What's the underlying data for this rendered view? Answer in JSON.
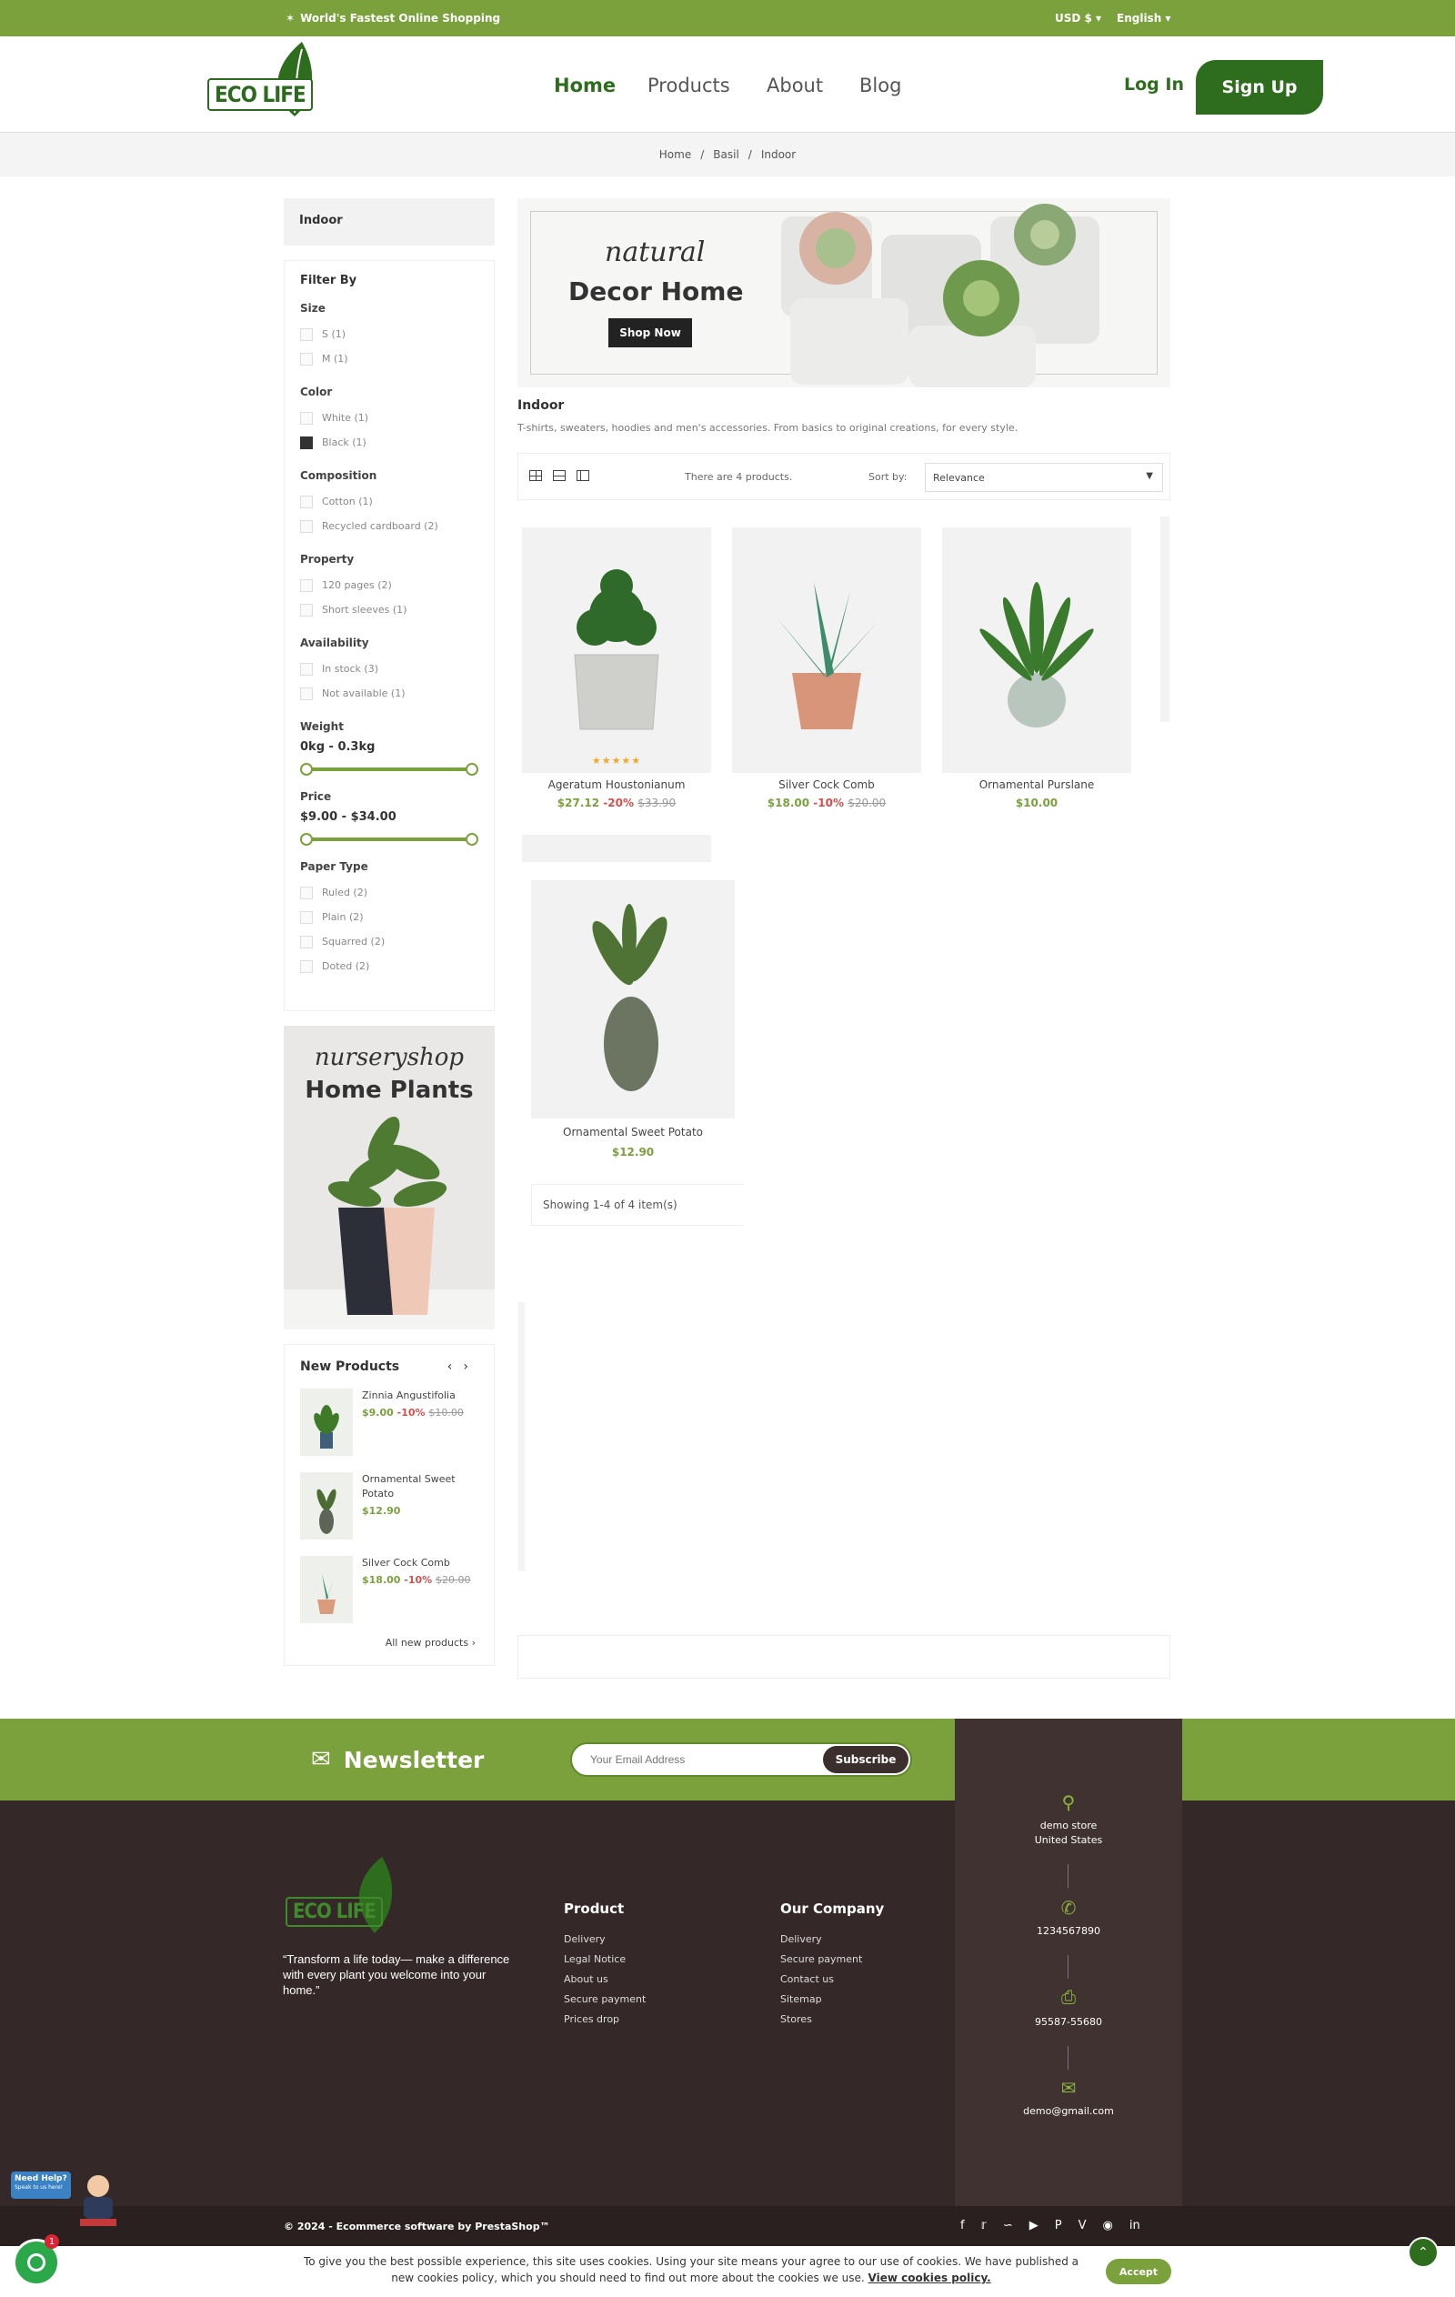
{
  "topbar": {
    "tagline": "World's Fastest Online Shopping",
    "currency": "USD $",
    "language": "English"
  },
  "header": {
    "logo": "ECO LIFE",
    "nav": [
      "Home",
      "Products",
      "About",
      "Blog"
    ],
    "login": "Log In",
    "signup": "Sign Up"
  },
  "breadcrumb": [
    "Home",
    "Basil",
    "Indoor"
  ],
  "sidebar": {
    "category": "Indoor",
    "filter_title": "Filter By",
    "groups": {
      "size": {
        "label": "Size",
        "items": [
          "S (1)",
          "M (1)"
        ]
      },
      "color": {
        "label": "Color",
        "items": [
          "White (1)",
          "Black (1)"
        ]
      },
      "composition": {
        "label": "Composition",
        "items": [
          "Cotton (1)",
          "Recycled cardboard (2)"
        ]
      },
      "property": {
        "label": "Property",
        "items": [
          "120 pages (2)",
          "Short sleeves (1)"
        ]
      },
      "availability": {
        "label": "Availability",
        "items": [
          "In stock (3)",
          "Not available (1)"
        ]
      },
      "weight": {
        "label": "Weight",
        "range": "0kg - 0.3kg"
      },
      "price": {
        "label": "Price",
        "range": "$9.00 - $34.00"
      },
      "paper": {
        "label": "Paper Type",
        "items": [
          "Ruled (2)",
          "Plain (2)",
          "Squarred (2)",
          "Doted (2)"
        ]
      }
    },
    "promo": {
      "script": "nurseryshop",
      "title": "Home Plants"
    },
    "new_products": {
      "title": "New Products",
      "items": [
        {
          "name": "Zinnia Angustifolia",
          "price": "$9.00",
          "discount": "-10%",
          "old": "$10.00"
        },
        {
          "name": "Ornamental Sweet Potato",
          "price": "$12.90",
          "discount": "",
          "old": ""
        },
        {
          "name": "Silver Cock Comb",
          "price": "$18.00",
          "discount": "-10%",
          "old": "$20.00"
        }
      ],
      "all_link": "All new products ›"
    }
  },
  "banner": {
    "script": "natural",
    "title": "Decor Home",
    "button": "Shop Now"
  },
  "category": {
    "title": "Indoor",
    "description": "T-shirts, sweaters, hoodies and men's accessories. From basics to original creations, for every style."
  },
  "toolbar": {
    "count": "There are 4 products.",
    "sort_label": "Sort by:",
    "sort_value": "Relevance"
  },
  "products": [
    {
      "name": "Ageratum Houstonianum",
      "price": "$27.12",
      "discount": "-20%",
      "old": "$33.90",
      "rating": 5
    },
    {
      "name": "Silver Cock Comb",
      "price": "$18.00",
      "discount": "-10%",
      "old": "$20.00"
    },
    {
      "name": "Ornamental Purslane",
      "price": "$10.00",
      "discount": "",
      "old": ""
    },
    {
      "name": "Ornamental Sweet Potato",
      "price": "$12.90",
      "discount": "",
      "old": ""
    }
  ],
  "showing": "Showing 1-4 of 4 item(s)",
  "newsletter": {
    "title": "Newsletter",
    "placeholder": "Your Email Address",
    "button": "Subscribe"
  },
  "footer": {
    "tagline": "“Transform a life today— make a difference with every plant you welcome into your home.”",
    "product_col": {
      "title": "Product",
      "links": [
        "Delivery",
        "Legal Notice",
        "About us",
        "Secure payment",
        "Prices drop"
      ]
    },
    "company_col": {
      "title": "Our Company",
      "links": [
        "Delivery",
        "Secure payment",
        "Contact us",
        "Sitemap",
        "Stores"
      ]
    },
    "contact": {
      "address1": "demo store",
      "address2": "United States",
      "phone": "1234567890",
      "fax": "95587-55680",
      "email": "demo@gmail.com"
    },
    "copyright": "© 2024 - Ecommerce software by PrestaShop™"
  },
  "cookie": {
    "text": "To give you the best possible experience, this site uses cookies. Using your site means your agree to our use of cookies. We have published a new cookies policy, which you should need to find out more about the cookies we use.",
    "link": "View cookies policy.",
    "accept": "Accept"
  },
  "help": {
    "title": "Need Help?",
    "sub": "Speak to us here!"
  },
  "chat_badge": "1",
  "colors": {
    "primary_green": "#7aa13c",
    "dark_green": "#2e6d1e",
    "footer_bg": "#342828",
    "sale_red": "#d94d4d"
  }
}
